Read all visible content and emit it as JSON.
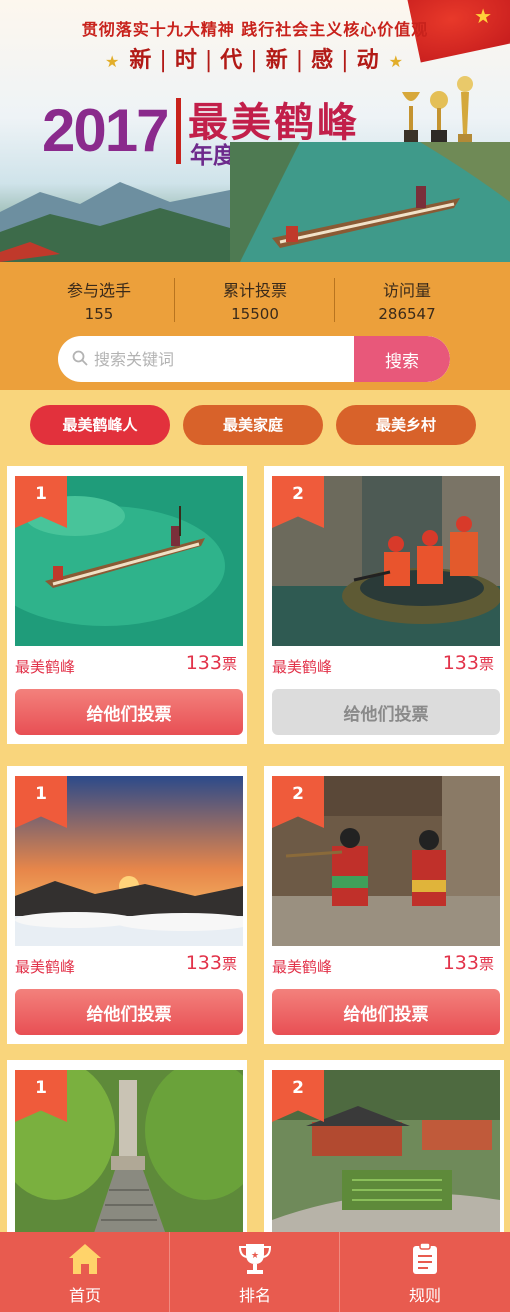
{
  "banner": {
    "slogan_line1": "贯彻落实十九大精神  践行社会主义核心价值观",
    "slogan_line2": [
      "新",
      "时",
      "代",
      "新",
      "感",
      "动"
    ],
    "year": "2017",
    "title": "最美鹤峰",
    "subtitle": "年度投票全面启动"
  },
  "stats": {
    "participants_label": "参与选手",
    "participants_value": "155",
    "total_votes_label": "累计投票",
    "total_votes_value": "15500",
    "visits_label": "访问量",
    "visits_value": "286547"
  },
  "search": {
    "placeholder": "搜索关键词",
    "button_label": "搜索"
  },
  "tabs": [
    {
      "label": "最美鹤峰人",
      "active": true
    },
    {
      "label": "最美家庭",
      "active": false
    },
    {
      "label": "最美乡村",
      "active": false
    }
  ],
  "cards": [
    {
      "rank": "1",
      "name": "最美鹤峰",
      "votes": "133",
      "votes_unit": "票",
      "button": "给他们投票",
      "button_state": "active",
      "photo": "boat-lake"
    },
    {
      "rank": "2",
      "name": "最美鹤峰",
      "votes": "133",
      "votes_unit": "票",
      "button": "给他们投票",
      "button_state": "disabled",
      "photo": "rafting"
    },
    {
      "rank": "1",
      "name": "最美鹤峰",
      "votes": "133",
      "votes_unit": "票",
      "button": "给他们投票",
      "button_state": "active",
      "photo": "sunset-clouds"
    },
    {
      "rank": "2",
      "name": "最美鹤峰",
      "votes": "133",
      "votes_unit": "票",
      "button": "给他们投票",
      "button_state": "active",
      "photo": "folk-girls"
    },
    {
      "rank": "1",
      "name": "",
      "votes": "",
      "votes_unit": "",
      "button": "",
      "button_state": "active",
      "photo": "monument-stairs"
    },
    {
      "rank": "2",
      "name": "",
      "votes": "",
      "votes_unit": "",
      "button": "",
      "button_state": "active",
      "photo": "village-road"
    }
  ],
  "bottom_nav": [
    {
      "label": "首页",
      "icon": "home-icon"
    },
    {
      "label": "排名",
      "icon": "trophy-icon"
    },
    {
      "label": "规则",
      "icon": "rules-icon"
    }
  ],
  "colors": {
    "page_bg": "#f9d57c",
    "stats_bg": "#eca03b",
    "accent_red": "#e2313c",
    "tab_orange": "#d8622a",
    "nav_bg": "#e85b4f",
    "search_button": "#e8587a"
  }
}
